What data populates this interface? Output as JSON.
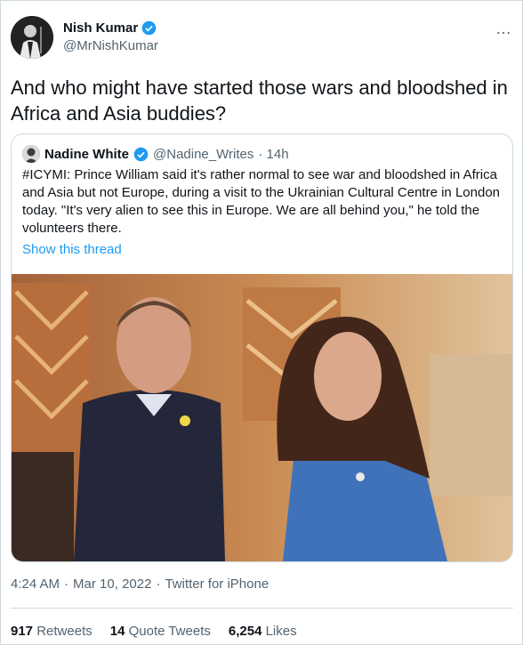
{
  "tweet": {
    "author": {
      "name": "Nish Kumar",
      "handle": "@MrNishKumar"
    },
    "text": "And who might have started those wars and bloodshed in Africa and Asia buddies?",
    "more_icon": "…",
    "timestamp": "4:24 AM",
    "date": "Mar 10, 2022",
    "source": "Twitter for iPhone",
    "separator": "·"
  },
  "quoted": {
    "name": "Nadine White",
    "handle": "@Nadine_Writes",
    "time": "· 14h",
    "text": "#ICYMI: Prince William said it's rather normal to see war and bloodshed in Africa and Asia but not Europe, during a visit to the Ukrainian Cultural Centre in London today. \"It's very alien to see this in Europe. We are all behind you,\" he told the volunteers there.",
    "show_thread": "Show this thread"
  },
  "stats": [
    {
      "value": "917",
      "label": "Retweets"
    },
    {
      "value": "14",
      "label": "Quote Tweets"
    },
    {
      "value": "6,254",
      "label": "Likes"
    }
  ],
  "colors": {
    "accent": "#1d9bf0",
    "muted": "#536471",
    "border": "#cfd9de",
    "text": "#0f1419"
  },
  "icons": {
    "verified": "verified-badge-icon",
    "more": "more-options-icon"
  }
}
